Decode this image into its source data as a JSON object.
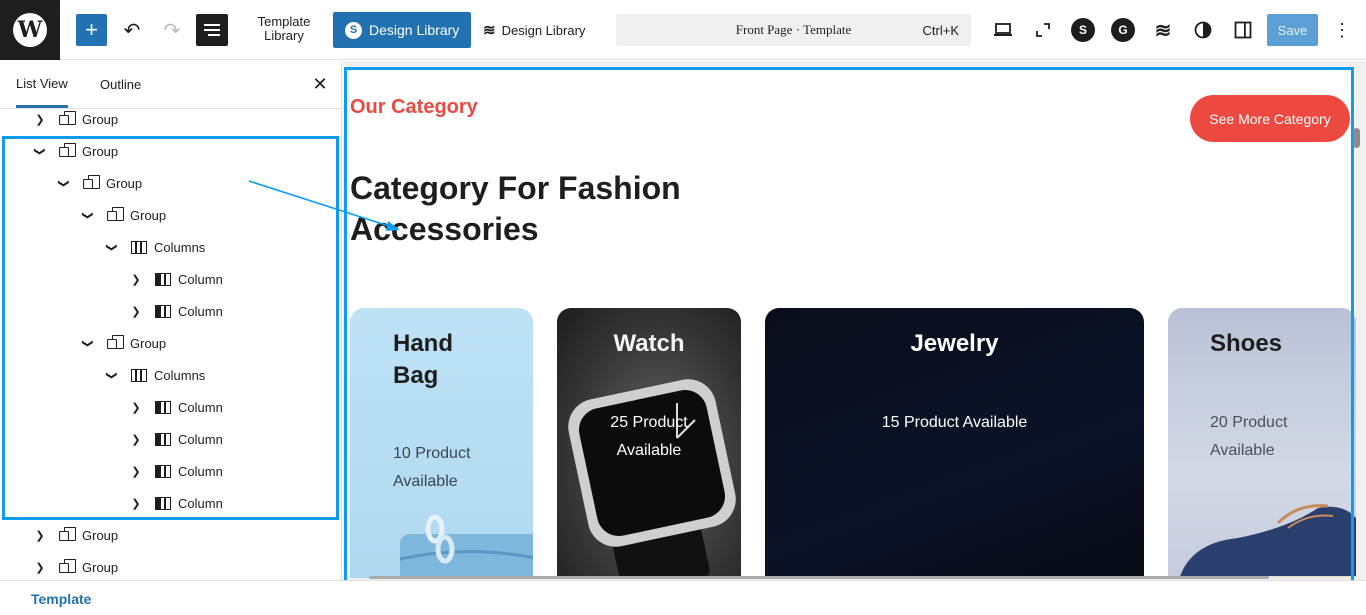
{
  "toolbar": {
    "add_label": "+",
    "undo_icon": "undo-icon",
    "redo_icon": "redo-icon",
    "template_library_label": "Template Library",
    "design_library_blue_label": "Design Library",
    "design_library_plain_label": "Design Library",
    "command_title": "Front Page · Template",
    "command_shortcut": "Ctrl+K",
    "save_label": "Save",
    "icons": [
      "desktop-icon",
      "fullscreen-icon",
      "stackable-s-icon",
      "gear-g-icon",
      "stackable-icon",
      "contrast-icon",
      "sidebar-icon",
      "more-vertical-icon"
    ]
  },
  "sidebar": {
    "tabs": [
      "List View",
      "Outline"
    ],
    "active_tab": "List View",
    "close_icon": "close-icon",
    "tree": [
      {
        "label": "Group",
        "type": "group",
        "expanded": false
      },
      {
        "label": "Group",
        "type": "group",
        "expanded": true
      },
      {
        "label": "Group",
        "type": "group",
        "expanded": true
      },
      {
        "label": "Group",
        "type": "group",
        "expanded": true
      },
      {
        "label": "Columns",
        "type": "columns",
        "expanded": true
      },
      {
        "label": "Column",
        "type": "column",
        "expanded": false
      },
      {
        "label": "Column",
        "type": "column",
        "expanded": false
      },
      {
        "label": "Group",
        "type": "group",
        "expanded": true
      },
      {
        "label": "Columns",
        "type": "columns",
        "expanded": true
      },
      {
        "label": "Column",
        "type": "column",
        "expanded": false
      },
      {
        "label": "Column",
        "type": "column",
        "expanded": false
      },
      {
        "label": "Column",
        "type": "column",
        "expanded": false
      },
      {
        "label": "Column",
        "type": "column",
        "expanded": false
      },
      {
        "label": "Group",
        "type": "group",
        "expanded": false
      },
      {
        "label": "Group",
        "type": "group",
        "expanded": false
      }
    ]
  },
  "footer": {
    "breadcrumb": "Template"
  },
  "canvas": {
    "eyebrow": "Our Category",
    "see_more_label": "See More Category",
    "heading_line1": "Category For Fashion",
    "heading_line2": "Accessories",
    "cards": [
      {
        "title_line1": "Hand",
        "title_line2": "Bag",
        "sub_line1": "10 Product",
        "sub_line2": "Available"
      },
      {
        "title_line1": "Watch",
        "title_line2": "",
        "sub_line1": "25 Product",
        "sub_line2": "Available"
      },
      {
        "title_line1": "Jewelry",
        "title_line2": "",
        "sub_line1": "15 Product Available",
        "sub_line2": ""
      },
      {
        "title_line1": "Shoes",
        "title_line2": "",
        "sub_line1": "20 Product",
        "sub_line2": "Available"
      }
    ]
  },
  "colors": {
    "accent_blue": "#2271b1",
    "highlight_blue": "#0d9cf0",
    "brand_red": "#ec4a40"
  }
}
